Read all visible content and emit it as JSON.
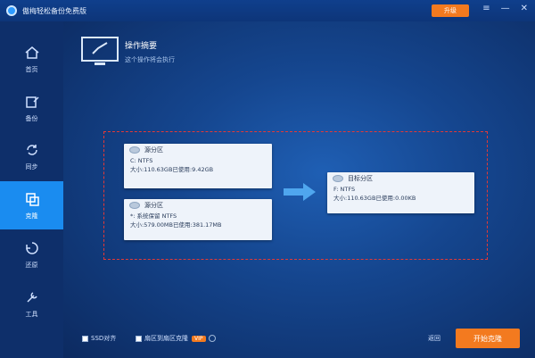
{
  "app": {
    "title": "傲梅轻松备份免费版",
    "upgrade_label": "升级"
  },
  "window_controls": {
    "menu": "≡",
    "minimize": "—",
    "close": "✕"
  },
  "sidebar": {
    "items": [
      {
        "label": "首页",
        "icon": "home-icon"
      },
      {
        "label": "备份",
        "icon": "backup-icon"
      },
      {
        "label": "同步",
        "icon": "sync-icon"
      },
      {
        "label": "克隆",
        "icon": "clone-icon",
        "active": true
      },
      {
        "label": "还原",
        "icon": "restore-icon"
      },
      {
        "label": "工具",
        "icon": "tools-icon"
      }
    ]
  },
  "header": {
    "title": "操作摘要",
    "subtitle": "这个操作将会执行"
  },
  "source": {
    "partition1": {
      "name": "源分区",
      "line1": "C: NTFS",
      "line2": "大小:110.63GB已使用:9.42GB"
    },
    "partition2": {
      "name": "源分区",
      "line1": "*: 系统保留 NTFS",
      "line2": "大小:579.00MB已使用:381.17MB"
    }
  },
  "target": {
    "name": "目标分区",
    "line1": "F: NTFS",
    "line2": "大小:110.63GB已使用:0.00KB"
  },
  "footer": {
    "option1": "SSD对齐",
    "option2": "扇区到扇区克隆",
    "option2_badge": "VIP",
    "back_label": "返回",
    "start_label": "开始克隆"
  },
  "colors": {
    "accent": "#f37a1f",
    "active_nav": "#1a8cf0",
    "summary_border": "#e53935"
  }
}
